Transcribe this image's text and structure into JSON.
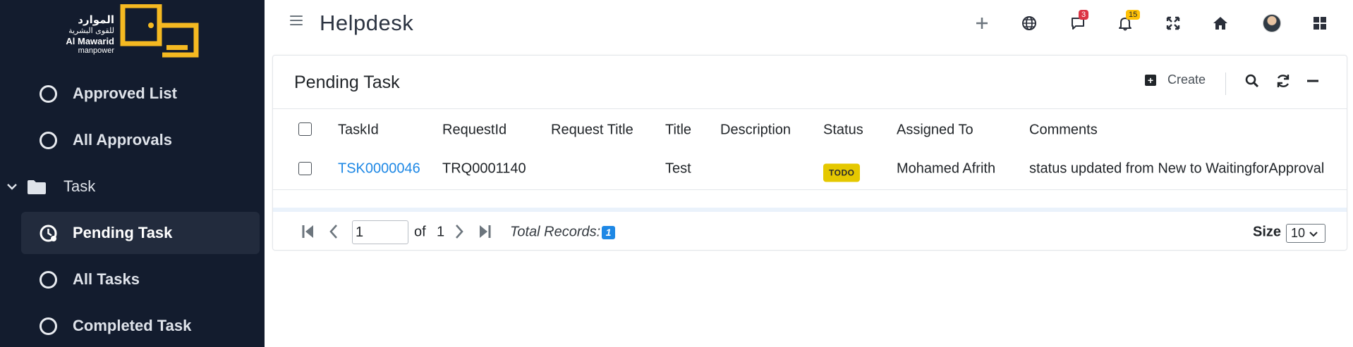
{
  "brand": {
    "arabic_line1": "الموارد",
    "arabic_line2": "للقوى البشرية",
    "name_line1": "Al Mawarid",
    "name_line2": "manpower",
    "accent_color": "#f5b921"
  },
  "sidebar": {
    "items": [
      {
        "label": "Approved List"
      },
      {
        "label": "All Approvals"
      }
    ],
    "group": {
      "label": "Task",
      "expanded": true
    },
    "sub_items": [
      {
        "label": "Pending Task",
        "active": true
      },
      {
        "label": "All Tasks"
      },
      {
        "label": "Completed Task"
      }
    ]
  },
  "topbar": {
    "title": "Helpdesk",
    "icons": [
      "plus-icon",
      "globe-icon",
      "chat-icon",
      "bell-icon",
      "fullscreen-icon",
      "home-icon",
      "avatar",
      "apps-grid-icon"
    ],
    "chat_badge": "3",
    "bell_badge": "15"
  },
  "card": {
    "title": "Pending Task",
    "create_label": "Create"
  },
  "table": {
    "headers": [
      "TaskId",
      "RequestId",
      "Request Title",
      "Title",
      "Description",
      "Status",
      "Assigned To",
      "Comments"
    ],
    "rows": [
      {
        "task_id": "TSK0000046",
        "request_id": "TRQ0001140",
        "request_title": "",
        "title": "Test",
        "description": "",
        "status": "TODO",
        "assigned_to": "Mohamed Afrith",
        "comments": "status updated from New to WaitingforApproval"
      }
    ]
  },
  "pager": {
    "current_page": "1",
    "of_label": "of",
    "total_pages": "1",
    "total_records_label": "Total Records:",
    "total_records": "1",
    "size_label": "Size",
    "size_value": "10"
  },
  "colors": {
    "sidebar_bg": "#131c2e",
    "active_bg": "#222b3d",
    "link": "#1e88e5",
    "todo_badge": "#e5c800"
  }
}
